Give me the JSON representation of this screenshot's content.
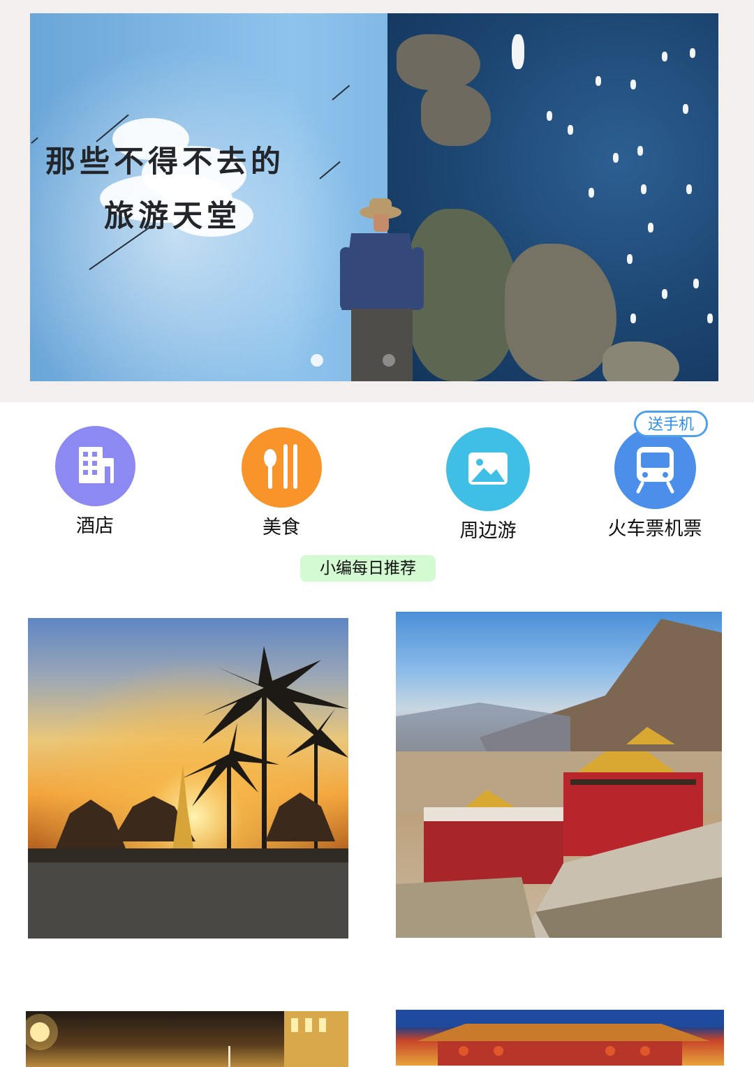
{
  "banner": {
    "title_line1": "那些不得不去的",
    "title_line2": "旅游天堂",
    "active_slide": 1,
    "slide_count": 2
  },
  "categories": [
    {
      "label": "酒店",
      "icon": "building-icon",
      "color": "#8d89f2"
    },
    {
      "label": "美食",
      "icon": "fork-knife-icon",
      "color": "#f8942a"
    },
    {
      "label": "周边游",
      "icon": "landscape-icon",
      "color": "#3fbfe6"
    },
    {
      "label": "火车票机票",
      "icon": "train-icon",
      "color": "#4b8fea",
      "badge": "送手机"
    }
  ],
  "recommend": {
    "label": "小编每日推荐"
  },
  "photos": [
    {
      "name": "sunset-temple-palms"
    },
    {
      "name": "tibetan-monastery-mountain"
    },
    {
      "name": "night-palace-lights"
    },
    {
      "name": "chinese-palace-roof"
    }
  ]
}
